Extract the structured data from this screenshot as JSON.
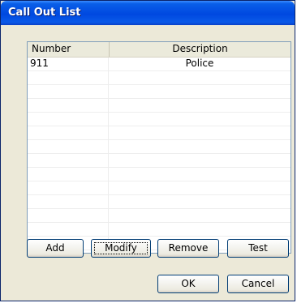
{
  "window": {
    "title": "Call Out List"
  },
  "list": {
    "columns": [
      "Number",
      "Description"
    ],
    "rows": [
      {
        "number": "911",
        "description": "Police"
      },
      {
        "number": "",
        "description": ""
      },
      {
        "number": "",
        "description": ""
      },
      {
        "number": "",
        "description": ""
      },
      {
        "number": "",
        "description": ""
      },
      {
        "number": "",
        "description": ""
      },
      {
        "number": "",
        "description": ""
      },
      {
        "number": "",
        "description": ""
      },
      {
        "number": "",
        "description": ""
      },
      {
        "number": "",
        "description": ""
      },
      {
        "number": "",
        "description": ""
      },
      {
        "number": "",
        "description": ""
      },
      {
        "number": "",
        "description": ""
      },
      {
        "number": "",
        "description": ""
      }
    ]
  },
  "buttons": {
    "add": "Add",
    "modify": "Modify",
    "remove": "Remove",
    "test": "Test",
    "ok": "OK",
    "cancel": "Cancel"
  }
}
